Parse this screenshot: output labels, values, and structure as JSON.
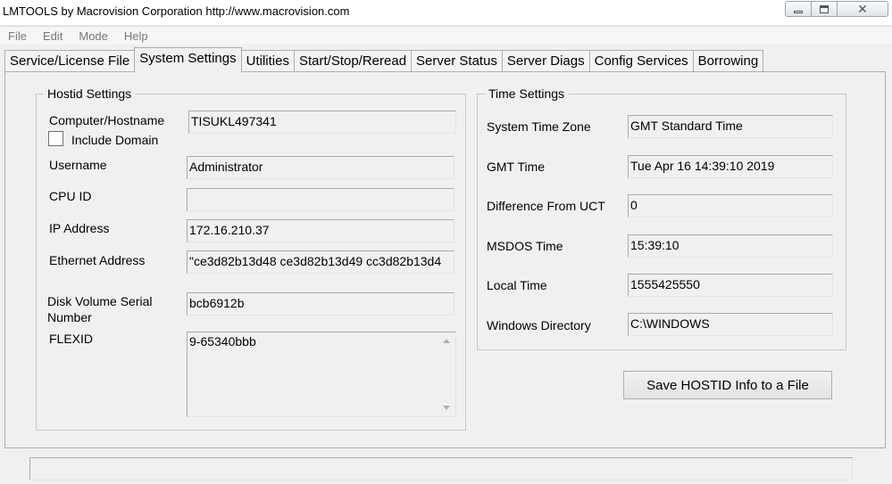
{
  "window": {
    "title": "LMTOOLS by Macrovision Corporation http://www.macrovision.com"
  },
  "menu": [
    "File",
    "Edit",
    "Mode",
    "Help"
  ],
  "tabs": [
    "Service/License File",
    "System Settings",
    "Utilities",
    "Start/Stop/Reread",
    "Server Status",
    "Server Diags",
    "Config Services",
    "Borrowing"
  ],
  "active_tab": "System Settings",
  "hostid": {
    "legend": "Hostid Settings",
    "computer_label": "Computer/Hostname",
    "computer_value": "TISUKL497341",
    "include_domain_label": "Include Domain",
    "username_label": "Username",
    "username_value": "Administrator",
    "cpu_label": "CPU ID",
    "cpu_value": "",
    "ip_label": "IP Address",
    "ip_value": "172.16.210.37",
    "ethernet_label": "Ethernet Address",
    "ethernet_value": "\"ce3d82b13d48 ce3d82b13d49 cc3d82b13d4",
    "disk_label_line1": "Disk Volume Serial",
    "disk_label_line2": "Number",
    "disk_value": "bcb6912b",
    "flexid_label": "FLEXID",
    "flexid_value": "9-65340bbb"
  },
  "time": {
    "legend": "Time Settings",
    "tz_label": "System Time Zone",
    "tz_value": "GMT Standard Time",
    "gmt_label": "GMT Time",
    "gmt_value": "Tue Apr 16 14:39:10 2019",
    "diff_label": "Difference From UCT",
    "diff_value": "0",
    "msdos_label": "MSDOS Time",
    "msdos_value": "15:39:10",
    "local_label": "Local Time",
    "local_value": "1555425550",
    "windir_label": "Windows Directory",
    "windir_value": "C:\\WINDOWS"
  },
  "save_button": "Save HOSTID Info to a File",
  "status_text": ""
}
